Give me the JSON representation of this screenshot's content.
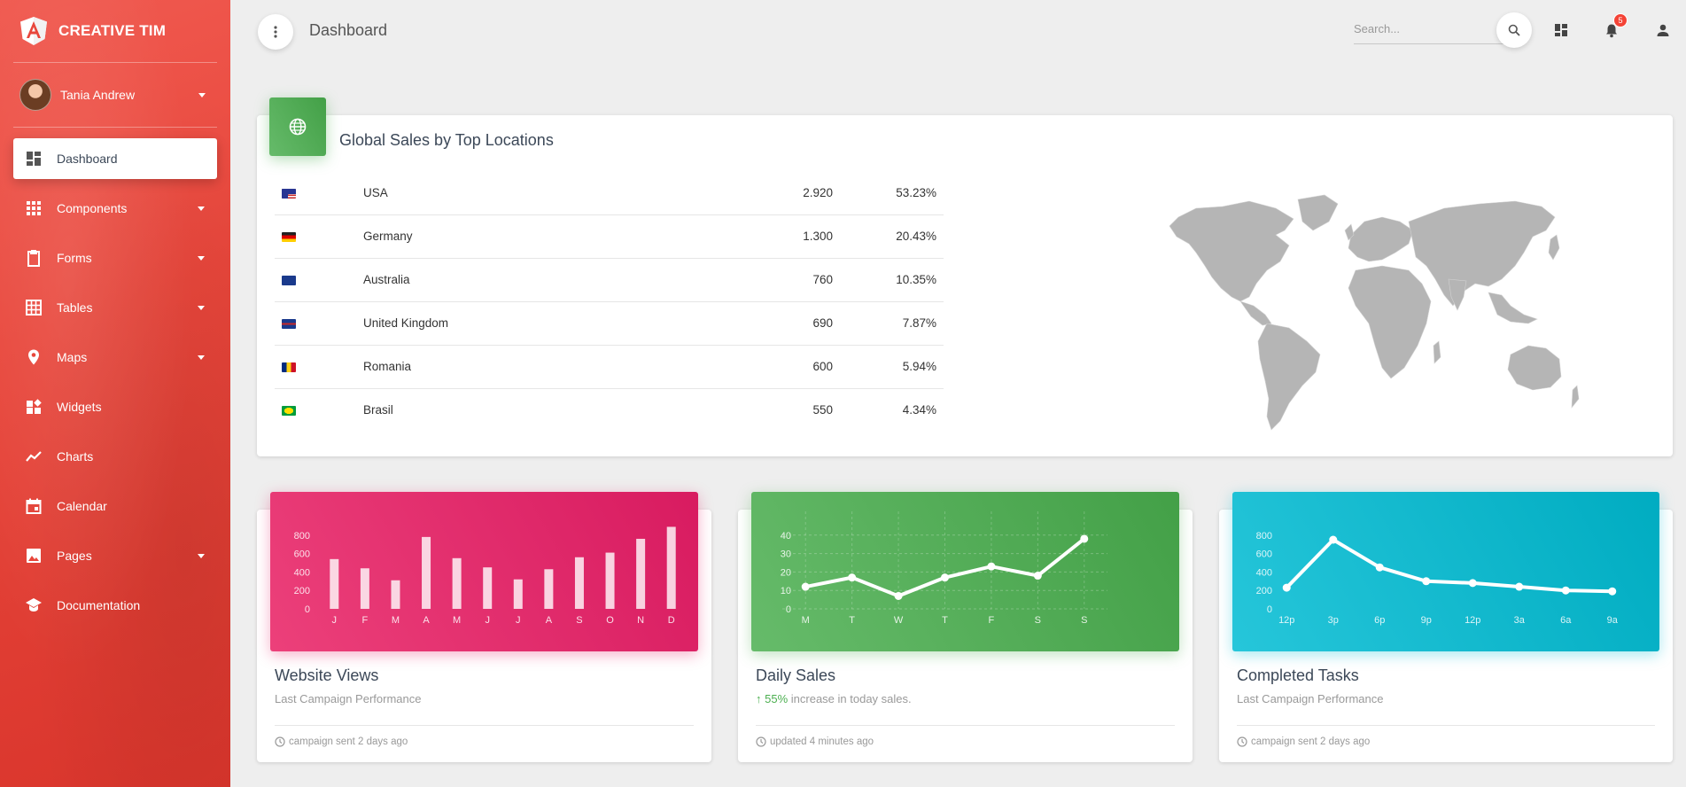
{
  "brand": {
    "name": "CREATIVE TIM"
  },
  "user": {
    "name": "Tania Andrew"
  },
  "sidebar": {
    "items": [
      {
        "label": "Dashboard",
        "icon": "dashboard-icon",
        "active": true,
        "caret": false
      },
      {
        "label": "Components",
        "icon": "apps-icon",
        "active": false,
        "caret": true
      },
      {
        "label": "Forms",
        "icon": "clipboard-icon",
        "active": false,
        "caret": true
      },
      {
        "label": "Tables",
        "icon": "grid-icon",
        "active": false,
        "caret": true
      },
      {
        "label": "Maps",
        "icon": "place-icon",
        "active": false,
        "caret": true
      },
      {
        "label": "Widgets",
        "icon": "widgets-icon",
        "active": false,
        "caret": false
      },
      {
        "label": "Charts",
        "icon": "timeline-icon",
        "active": false,
        "caret": false
      },
      {
        "label": "Calendar",
        "icon": "calendar-icon",
        "active": false,
        "caret": false
      },
      {
        "label": "Pages",
        "icon": "image-icon",
        "active": false,
        "caret": true
      },
      {
        "label": "Documentation",
        "icon": "school-icon",
        "active": false,
        "caret": false
      }
    ]
  },
  "header": {
    "title": "Dashboard",
    "search_placeholder": "Search...",
    "notification_count": "5"
  },
  "sales": {
    "title": "Global Sales by Top Locations",
    "rows": [
      {
        "country": "USA",
        "flag": "us-flag",
        "sales": "2.920",
        "percent": "53.23%"
      },
      {
        "country": "Germany",
        "flag": "de-flag",
        "sales": "1.300",
        "percent": "20.43%"
      },
      {
        "country": "Australia",
        "flag": "au-flag",
        "sales": "760",
        "percent": "10.35%"
      },
      {
        "country": "United Kingdom",
        "flag": "gb-flag",
        "sales": "690",
        "percent": "7.87%"
      },
      {
        "country": "Romania",
        "flag": "ro-flag",
        "sales": "600",
        "percent": "5.94%"
      },
      {
        "country": "Brasil",
        "flag": "br-flag",
        "sales": "550",
        "percent": "4.34%"
      }
    ]
  },
  "charts": [
    {
      "title": "Website Views",
      "subtitle": "Last Campaign Performance",
      "footer": "campaign sent 2 days ago",
      "color": "pink"
    },
    {
      "title": "Daily Sales",
      "subtitle_highlight": "55%",
      "subtitle": " increase in today sales.",
      "footer": "updated 4 minutes ago",
      "color": "green"
    },
    {
      "title": "Completed Tasks",
      "subtitle": "Last Campaign Performance",
      "footer": "campaign sent 2 days ago",
      "color": "cyan"
    }
  ],
  "chart_data": [
    {
      "type": "bar",
      "categories": [
        "J",
        "F",
        "M",
        "A",
        "M",
        "J",
        "J",
        "A",
        "S",
        "O",
        "N",
        "D"
      ],
      "values": [
        540,
        440,
        310,
        780,
        550,
        450,
        320,
        430,
        560,
        610,
        760,
        890
      ],
      "yticks": [
        "800",
        "600",
        "400",
        "200",
        "0"
      ],
      "ylim": [
        0,
        1000
      ],
      "grid": false
    },
    {
      "type": "line",
      "categories": [
        "M",
        "T",
        "W",
        "T",
        "F",
        "S",
        "S"
      ],
      "values": [
        12,
        17,
        7,
        17,
        23,
        18,
        38
      ],
      "yticks": [
        "40",
        "30",
        "20",
        "10",
        "0"
      ],
      "ylim": [
        0,
        50
      ],
      "grid": true
    },
    {
      "type": "line",
      "categories": [
        "12p",
        "3p",
        "6p",
        "9p",
        "12p",
        "3a",
        "6a",
        "9a"
      ],
      "values": [
        230,
        750,
        450,
        300,
        280,
        240,
        200,
        190
      ],
      "yticks": [
        "800",
        "600",
        "400",
        "200",
        "0"
      ],
      "ylim": [
        0,
        1000
      ],
      "grid": false
    }
  ]
}
